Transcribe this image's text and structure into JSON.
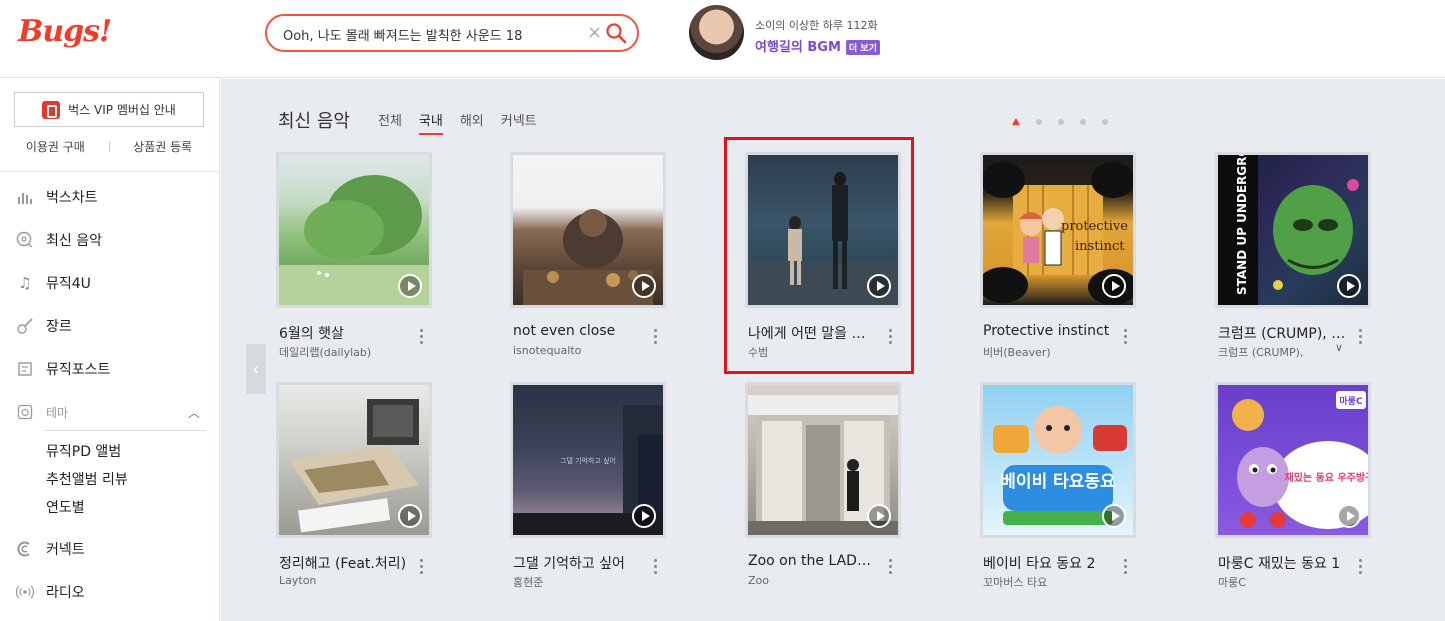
{
  "header": {
    "logo": "Bugs!",
    "search": {
      "value": "Ooh, 나도 몰래 빠져드는 발칙한 사운드 18",
      "clear": "×"
    },
    "promo": {
      "subtitle": "소이의 이상한 하루 112화",
      "title": "여행길의 BGM",
      "more": "더 보기"
    }
  },
  "sidebar": {
    "vip": "벅스 VIP 멤버십 안내",
    "links": [
      "이용권 구매",
      "상품권 등록"
    ],
    "nav": [
      {
        "label": "벅스차트",
        "icon": "chart-icon"
      },
      {
        "label": "최신 음악",
        "icon": "new-music-icon"
      },
      {
        "label": "뮤직4U",
        "icon": "music-note-icon"
      },
      {
        "label": "장르",
        "icon": "guitar-icon"
      },
      {
        "label": "뮤직포스트",
        "icon": "post-icon"
      }
    ],
    "theme": {
      "label": "테마",
      "items": [
        "뮤직PD 앨범",
        "추천앨범 리뷰",
        "연도별"
      ]
    },
    "bottom": [
      {
        "label": "커넥트",
        "icon": "connect-icon"
      },
      {
        "label": "라디오",
        "icon": "radio-icon"
      }
    ]
  },
  "main": {
    "section_title": "최신 음악",
    "tabs": [
      "전체",
      "국내",
      "해외",
      "커넥트"
    ],
    "active_tab": "국내",
    "page_dots": 5,
    "albums": [
      {
        "title": "6월의 햇살",
        "artist": "데일리랩(dailylab)"
      },
      {
        "title": "not even close",
        "artist": "isnotequalto"
      },
      {
        "title": "나에게 어떤 말을 하려 ...",
        "artist": "수범"
      },
      {
        "title": "Protective instinct",
        "artist": "비버(Beaver)"
      },
      {
        "title": "크럼프 (CRUMP), VI...",
        "artist": "크럼프 (CRUMP), "
      },
      {
        "title": "정리해고 (Feat.처리)",
        "artist": "Layton"
      },
      {
        "title": "그댈 기억하고 싶어",
        "artist": "홍현준"
      },
      {
        "title": "Zoo on the LADEAT ...",
        "artist": "Zoo"
      },
      {
        "title": "베이비 타요 동요 2",
        "artist": "꼬마버스 타요"
      },
      {
        "title": "마룽C 재밌는 동요 1",
        "artist": "마룽C"
      }
    ],
    "cover_texts": {
      "a5": "STAND UP UNDERGROUND",
      "a9": "베이비 타요동요",
      "a10_badge": "마룽C",
      "a10_text": "재밌는 동요 우주방귀송"
    }
  }
}
